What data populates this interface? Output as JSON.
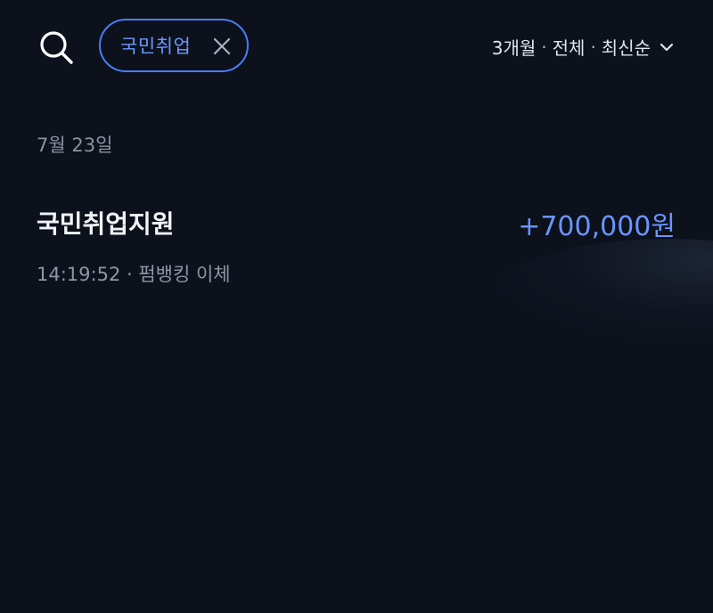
{
  "header": {
    "search_icon": "search-icon",
    "filter_chip": {
      "label": "국민취업",
      "close_icon": "close-icon"
    },
    "filter_summary": {
      "period": "3개월",
      "type": "전체",
      "sort": "최신순",
      "separator": "·",
      "chevron_icon": "chevron-down-icon"
    }
  },
  "groups": [
    {
      "date": "7월 23일",
      "transactions": [
        {
          "title": "국민취업지원",
          "amount": "+700,000원",
          "meta": "14:19:52 · 펌뱅킹 이체"
        }
      ]
    }
  ],
  "colors": {
    "background": "#0c111c",
    "accent": "#6a95ff",
    "chip_border": "#4a7cf5",
    "muted_text": "#8f96a3"
  }
}
